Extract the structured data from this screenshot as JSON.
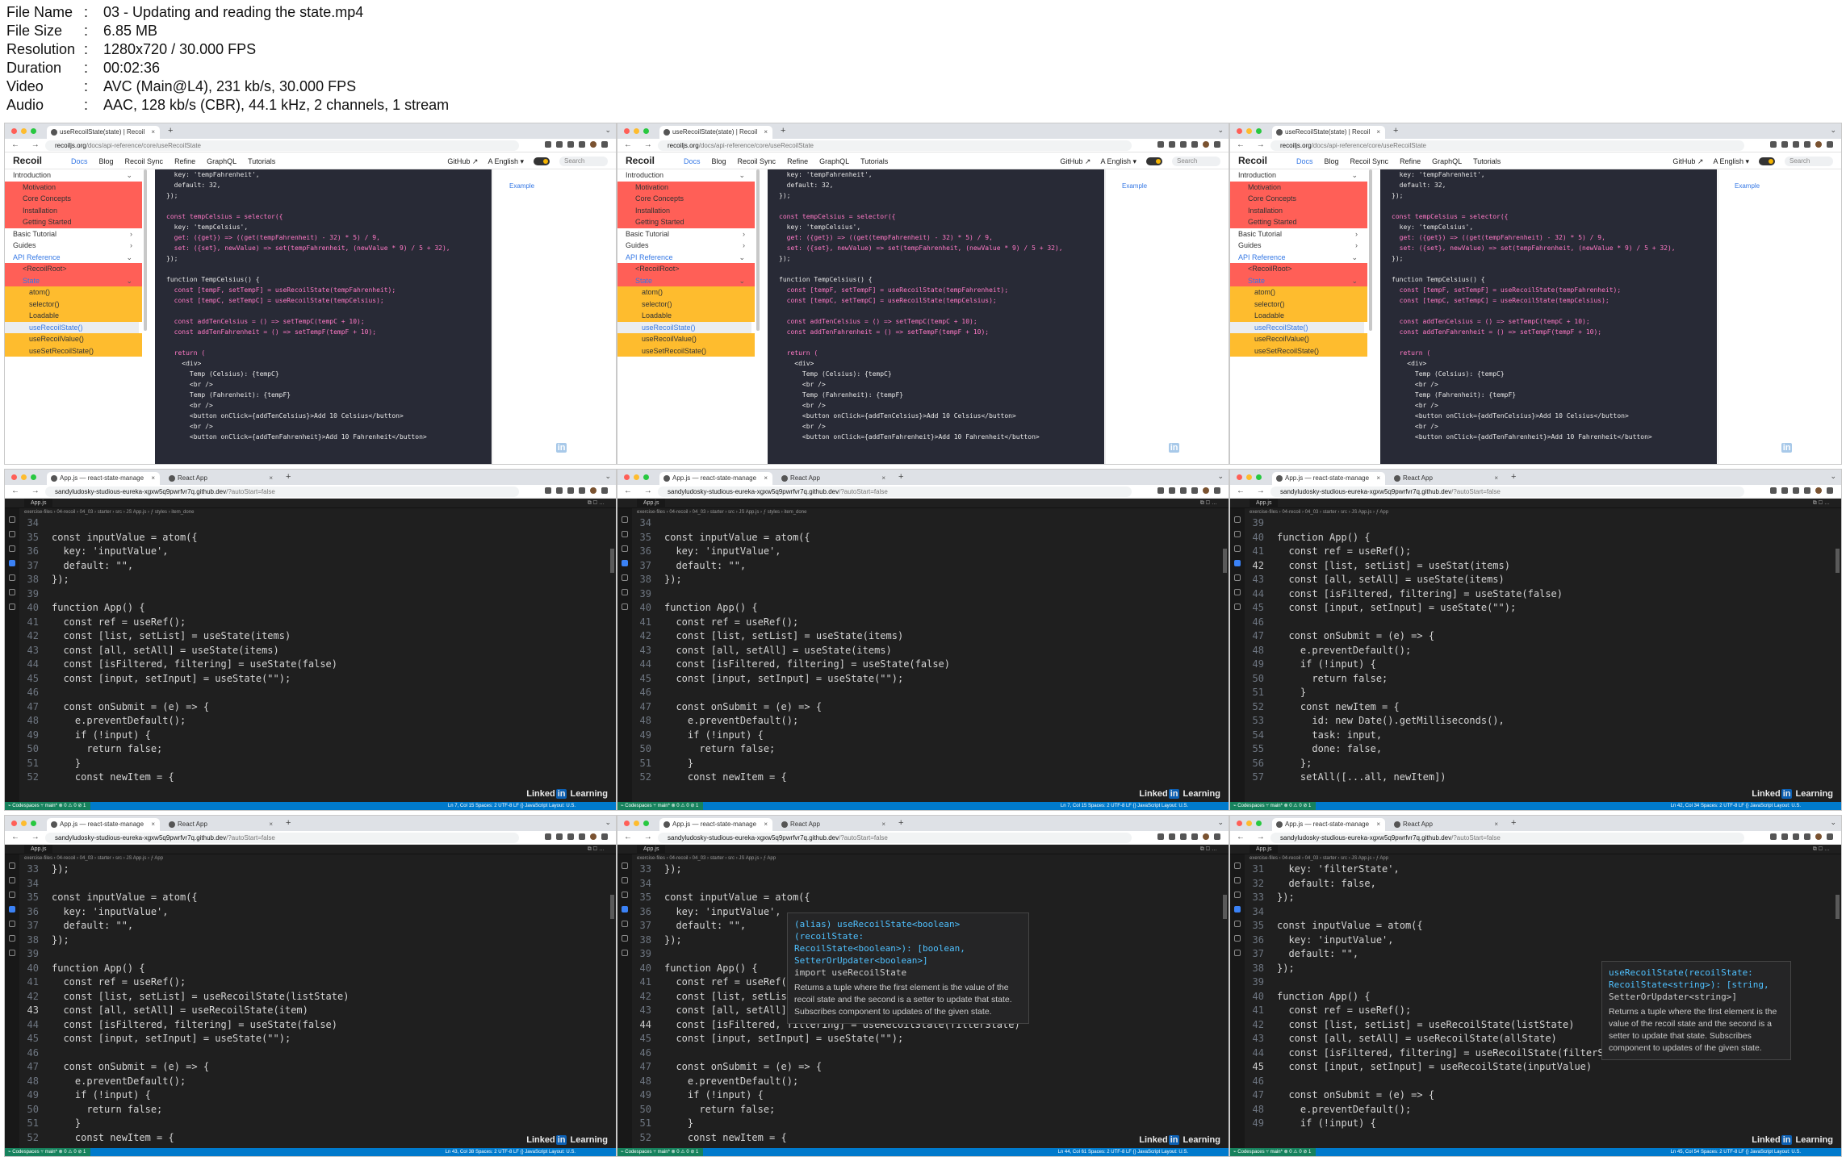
{
  "meta": [
    {
      "key": "File Name",
      "value": "03 - Updating and reading the state.mp4"
    },
    {
      "key": "File Size",
      "value": "6.85 MB"
    },
    {
      "key": "Resolution",
      "value": "1280x720 / 30.000 FPS"
    },
    {
      "key": "Duration",
      "value": "00:02:36"
    },
    {
      "key": "Video",
      "value": "AVC (Main@L4), 231 kb/s, 30.000 FPS"
    },
    {
      "key": "Audio",
      "value": "AAC, 128 kb/s (CBR), 44.1 kHz, 2 channels, 1 stream"
    }
  ],
  "watermark": {
    "pre": "Linked",
    "in": "in",
    "post": " Learning"
  },
  "docs": {
    "tab_title": "useRecoilState(state) | Recoil",
    "url_host": "recoiljs.org",
    "url_path": "/docs/api-reference/core/useRecoilState",
    "brand": "Recoil",
    "nav": [
      "Docs",
      "Blog",
      "Recoil Sync",
      "Refine",
      "GraphQL",
      "Tutorials"
    ],
    "nav_right": [
      "GitHub ↗",
      "A English ▾"
    ],
    "search": "Search",
    "toc": "Example",
    "sidebar": [
      {
        "label": "Introduction",
        "level": 0,
        "chev": "⌄"
      },
      {
        "label": "Motivation",
        "level": 1
      },
      {
        "label": "Core Concepts",
        "level": 1
      },
      {
        "label": "Installation",
        "level": 1
      },
      {
        "label": "Getting Started",
        "level": 1
      },
      {
        "label": "Basic Tutorial",
        "level": 0,
        "chev": "›"
      },
      {
        "label": "Guides",
        "level": 0,
        "chev": "›"
      },
      {
        "label": "API Reference",
        "level": 0,
        "chev": "⌄",
        "on": true
      },
      {
        "label": "<RecoilRoot>",
        "level": 1
      },
      {
        "label": "State",
        "level": 1,
        "chev": "⌄",
        "on": true
      },
      {
        "label": "atom()",
        "level": 2
      },
      {
        "label": "selector()",
        "level": 2
      },
      {
        "label": "Loadable",
        "level": 2
      },
      {
        "label": "useRecoilState()",
        "level": 2,
        "sel": true
      },
      {
        "label": "useRecoilValue()",
        "level": 2
      },
      {
        "label": "useSetRecoilState()",
        "level": 2
      }
    ],
    "code": [
      "  key: 'tempFahrenheit',",
      "  default: 32,",
      "});",
      "",
      "const tempCelsius = selector({",
      "  key: 'tempCelsius',",
      "  get: ({get}) => ((get(tempFahrenheit) - 32) * 5) / 9,",
      "  set: ({set}, newValue) => set(tempFahrenheit, (newValue * 9) / 5 + 32),",
      "});",
      "",
      "function TempCelsius() {",
      "  const [tempF, setTempF] = useRecoilState(tempFahrenheit);",
      "  const [tempC, setTempC] = useRecoilState(tempCelsius);",
      "",
      "  const addTenCelsius = () => setTempC(tempC + 10);",
      "  const addTenFahrenheit = () => setTempF(tempF + 10);",
      "",
      "  return (",
      "    <div>",
      "      Temp (Celsius): {tempC}",
      "      <br />",
      "      Temp (Fahrenheit): {tempF}",
      "      <br />",
      "      <button onClick={addTenCelsius}>Add 10 Celsius</button>",
      "      <br />",
      "      <button onClick={addTenFahrenheit}>Add 10 Fahrenheit</button>"
    ]
  },
  "ide": {
    "tab1": "App.js — react-state-manage",
    "tab2": "React App",
    "url_host": "sandyludosky-studious-eureka-xgxw5q9pwrfvr7q.github.dev",
    "url_path": "/?autoStart=false",
    "file_tab": "App.js",
    "actions": "⧉ ▢ …",
    "breadcrumb_a": "exercise-files › 04-recoil › 04_03 › starter › src › JS App.js › ƒ styles › item_done",
    "breadcrumb_b": "exercise-files › 04-recoil › 04_03 › starter › src › JS App.js › ƒ App",
    "status_left": "⌁ Codespaces   ⑂ main*   ⊗ 0 ⚠ 0   ⊘ 1",
    "status_a": "Ln 7, Col 15   Spaces: 2   UTF-8   LF   {} JavaScript   Layout: U.S.",
    "status_b": "Ln 42, Col 34   Spaces: 2   UTF-8   LF   {} JavaScript   Layout: U.S.",
    "status_c": "Ln 43, Col 38   Spaces: 2   UTF-8   LF   {} JavaScript   Layout: U.S.",
    "status_d": "Ln 44, Col 61   Spaces: 2   UTF-8   LF   {} JavaScript   Layout: U.S.",
    "status_e": "Ln 45, Col 54   Spaces: 2   UTF-8   LF   {} JavaScript   Layout: U.S."
  },
  "code_a": [
    {
      "n": "34",
      "t": ""
    },
    {
      "n": "35",
      "t": "const inputValue = atom({"
    },
    {
      "n": "36",
      "t": "  key: 'inputValue',"
    },
    {
      "n": "37",
      "t": "  default: \"\","
    },
    {
      "n": "38",
      "t": "});"
    },
    {
      "n": "39",
      "t": ""
    },
    {
      "n": "40",
      "t": "function App() {"
    },
    {
      "n": "41",
      "t": "  const ref = useRef();"
    },
    {
      "n": "42",
      "t": "  const [list, setList] = useState(items)"
    },
    {
      "n": "43",
      "t": "  const [all, setAll] = useState(items)"
    },
    {
      "n": "44",
      "t": "  const [isFiltered, filtering] = useState(false)"
    },
    {
      "n": "45",
      "t": "  const [input, setInput] = useState(\"\");"
    },
    {
      "n": "46",
      "t": ""
    },
    {
      "n": "47",
      "t": "  const onSubmit = (e) => {"
    },
    {
      "n": "48",
      "t": "    e.preventDefault();"
    },
    {
      "n": "49",
      "t": "    if (!input) {"
    },
    {
      "n": "50",
      "t": "      return false;"
    },
    {
      "n": "51",
      "t": "    }"
    },
    {
      "n": "52",
      "t": "    const newItem = {"
    }
  ],
  "code_b": [
    {
      "n": "39",
      "t": ""
    },
    {
      "n": "40",
      "t": "function App() {"
    },
    {
      "n": "41",
      "t": "  const ref = useRef();"
    },
    {
      "n": "42",
      "t": "  const [list, setList] = useStat(items)"
    },
    {
      "n": "43",
      "t": "  const [all, setAll] = useState(items)"
    },
    {
      "n": "44",
      "t": "  const [isFiltered, filtering] = useState(false)"
    },
    {
      "n": "45",
      "t": "  const [input, setInput] = useState(\"\");"
    },
    {
      "n": "46",
      "t": ""
    },
    {
      "n": "47",
      "t": "  const onSubmit = (e) => {"
    },
    {
      "n": "48",
      "t": "    e.preventDefault();"
    },
    {
      "n": "49",
      "t": "    if (!input) {"
    },
    {
      "n": "50",
      "t": "      return false;"
    },
    {
      "n": "51",
      "t": "    }"
    },
    {
      "n": "52",
      "t": "    const newItem = {"
    },
    {
      "n": "53",
      "t": "      id: new Date().getMilliseconds(),"
    },
    {
      "n": "54",
      "t": "      task: input,"
    },
    {
      "n": "55",
      "t": "      done: false,"
    },
    {
      "n": "56",
      "t": "    };"
    },
    {
      "n": "57",
      "t": "    setAll([...all, newItem])"
    }
  ],
  "code_c": [
    {
      "n": "33",
      "t": "});"
    },
    {
      "n": "34",
      "t": ""
    },
    {
      "n": "35",
      "t": "const inputValue = atom({"
    },
    {
      "n": "36",
      "t": "  key: 'inputValue',"
    },
    {
      "n": "37",
      "t": "  default: \"\","
    },
    {
      "n": "38",
      "t": "});"
    },
    {
      "n": "39",
      "t": ""
    },
    {
      "n": "40",
      "t": "function App() {"
    },
    {
      "n": "41",
      "t": "  const ref = useRef();"
    },
    {
      "n": "42",
      "t": "  const [list, setList] = useRecoilState(listState)"
    },
    {
      "n": "43",
      "t": "  const [all, setAll] = useRecoilState(item)"
    },
    {
      "n": "44",
      "t": "  const [isFiltered, filtering] = useState(false)"
    },
    {
      "n": "45",
      "t": "  const [input, setInput] = useState(\"\");"
    },
    {
      "n": "46",
      "t": ""
    },
    {
      "n": "47",
      "t": "  const onSubmit = (e) => {"
    },
    {
      "n": "48",
      "t": "    e.preventDefault();"
    },
    {
      "n": "49",
      "t": "    if (!input) {"
    },
    {
      "n": "50",
      "t": "      return false;"
    },
    {
      "n": "51",
      "t": "    }"
    },
    {
      "n": "52",
      "t": "    const newItem = {"
    }
  ],
  "code_d": [
    {
      "n": "33",
      "t": "});"
    },
    {
      "n": "34",
      "t": ""
    },
    {
      "n": "35",
      "t": "const inputValue = atom({"
    },
    {
      "n": "36",
      "t": "  key: 'inputValue',"
    },
    {
      "n": "37",
      "t": "  default: \"\","
    },
    {
      "n": "38",
      "t": "});"
    },
    {
      "n": "39",
      "t": ""
    },
    {
      "n": "40",
      "t": "function App() {"
    },
    {
      "n": "41",
      "t": "  const ref = useRef();"
    },
    {
      "n": "42",
      "t": "  const [list, setList] = useRecoilState(listState)"
    },
    {
      "n": "43",
      "t": "  const [all, setAll] = useRecoilState(allState)"
    },
    {
      "n": "44",
      "t": "  const [isFiltered, filtering] = useRecoilState(filterState)"
    },
    {
      "n": "45",
      "t": "  const [input, setInput] = useState(\"\");"
    },
    {
      "n": "46",
      "t": ""
    },
    {
      "n": "47",
      "t": "  const onSubmit = (e) => {"
    },
    {
      "n": "48",
      "t": "    e.preventDefault();"
    },
    {
      "n": "49",
      "t": "    if (!input) {"
    },
    {
      "n": "50",
      "t": "      return false;"
    },
    {
      "n": "51",
      "t": "    }"
    },
    {
      "n": "52",
      "t": "    const newItem = {"
    }
  ],
  "code_e": [
    {
      "n": "31",
      "t": "  key: 'filterState',"
    },
    {
      "n": "32",
      "t": "  default: false,"
    },
    {
      "n": "33",
      "t": "});"
    },
    {
      "n": "34",
      "t": ""
    },
    {
      "n": "35",
      "t": "const inputValue = atom({"
    },
    {
      "n": "36",
      "t": "  key: 'inputValue',"
    },
    {
      "n": "37",
      "t": "  default: \"\","
    },
    {
      "n": "38",
      "t": "});"
    },
    {
      "n": "39",
      "t": ""
    },
    {
      "n": "40",
      "t": "function App() {"
    },
    {
      "n": "41",
      "t": "  const ref = useRef();"
    },
    {
      "n": "42",
      "t": "  const [list, setList] = useRecoilState(listState)"
    },
    {
      "n": "43",
      "t": "  const [all, setAll] = useRecoilState(allState)"
    },
    {
      "n": "44",
      "t": "  const [isFiltered, filtering] = useRecoilState(filterState)"
    },
    {
      "n": "45",
      "t": "  const [input, setInput] = useRecoilState(inputValue)"
    },
    {
      "n": "46",
      "t": ""
    },
    {
      "n": "47",
      "t": "  const onSubmit = (e) => {"
    },
    {
      "n": "48",
      "t": "    e.preventDefault();"
    },
    {
      "n": "49",
      "t": "    if (!input) {"
    }
  ],
  "tip_d": {
    "sig1": "(alias) useRecoilState<boolean>(recoilState:",
    "sig2": "RecoilState<boolean>): [boolean, SetterOrUpdater<boolean>]",
    "sig3": "import useRecoilState",
    "doc": "Returns a tuple where the first element is the value of the recoil state and the second is a setter to update that state. Subscribes component to updates of the given state."
  },
  "tip_e": {
    "sig1": "useRecoilState(recoilState:",
    "sig2": "RecoilState<string>): [string,",
    "sig3": "SetterOrUpdater<string>]",
    "doc": "Returns a tuple where the first element is the value of the recoil state and the second is a setter to update that state. Subscribes component to updates of the given state."
  }
}
